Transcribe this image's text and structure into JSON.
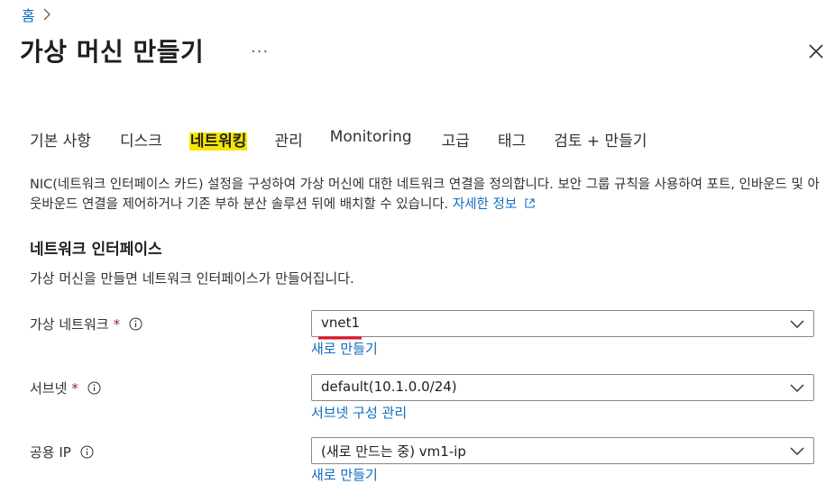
{
  "breadcrumb": {
    "home": "홈"
  },
  "header": {
    "title": "가상 머신 만들기",
    "more": "···"
  },
  "tabs": [
    {
      "label": "기본 사항"
    },
    {
      "label": "디스크"
    },
    {
      "label": "네트워킹",
      "active": true
    },
    {
      "label": "관리"
    },
    {
      "label": "Monitoring"
    },
    {
      "label": "고급"
    },
    {
      "label": "태그"
    },
    {
      "label": "검토 + 만들기"
    }
  ],
  "description": {
    "text": "NIC(네트워크 인터페이스 카드) 설정을 구성하여 가상 머신에 대한 네트워크 연결을 정의합니다. 보안 그룹 규칙을 사용하여 포트, 인바운드 및 아웃바운드 연결을 제어하거나 기존 부하 분산 솔루션 뒤에 배치할 수 있습니다.",
    "learn_more": "자세한 정보"
  },
  "section": {
    "title": "네트워크 인터페이스",
    "description": "가상 머신을 만들면 네트워크 인터페이스가 만들어집니다."
  },
  "fields": {
    "vnet": {
      "label": "가상 네트워크",
      "required": "*",
      "value": "vnet1",
      "link": "새로 만들기"
    },
    "subnet": {
      "label": "서브넷",
      "required": "*",
      "value": "default(10.1.0.0/24)",
      "link": "서브넷 구성 관리"
    },
    "public_ip": {
      "label": "공용 IP",
      "value": "(새로 만드는 중) vm1-ip",
      "link": "새로 만들기"
    }
  },
  "colors": {
    "link": "#0f6cbd",
    "tab_highlight": "#f5e600",
    "required": "#a4262c",
    "annotation_underline": "#e81123"
  },
  "icons": {
    "breadcrumb_separator": "chevron-right-icon",
    "close": "close-icon",
    "info": "info-icon",
    "dropdown": "chevron-down-icon",
    "external": "external-link-icon"
  }
}
